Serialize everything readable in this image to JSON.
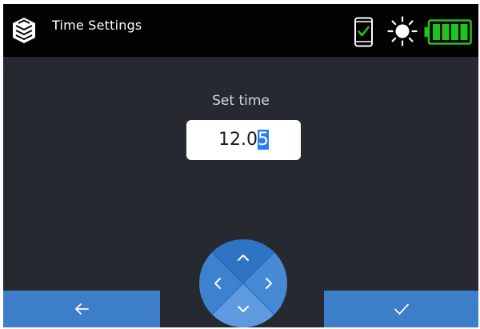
{
  "header": {
    "app_icon": "cube-stack-icon",
    "title": "Time Settings",
    "status_icons": [
      "phone-check-icon",
      "brightness-sun-icon",
      "battery-full-icon"
    ],
    "battery_level": 1.0
  },
  "main": {
    "label": "Set time",
    "time_value": {
      "prefix": "12.0",
      "selected": "5"
    }
  },
  "controls": {
    "back_icon": "arrow-left-icon",
    "confirm_icon": "checkmark-icon",
    "dpad_icons": [
      "chevron-up-icon",
      "chevron-left-icon",
      "chevron-right-icon",
      "chevron-down-icon"
    ]
  },
  "colors": {
    "background": "#262a30",
    "header": "#020202",
    "button": "#3d7ec8",
    "dpad_dark": "#2f74c4",
    "dpad_light": "#5d9ae0",
    "selection": "#2a7ff0",
    "status_green": "#22c21c"
  }
}
